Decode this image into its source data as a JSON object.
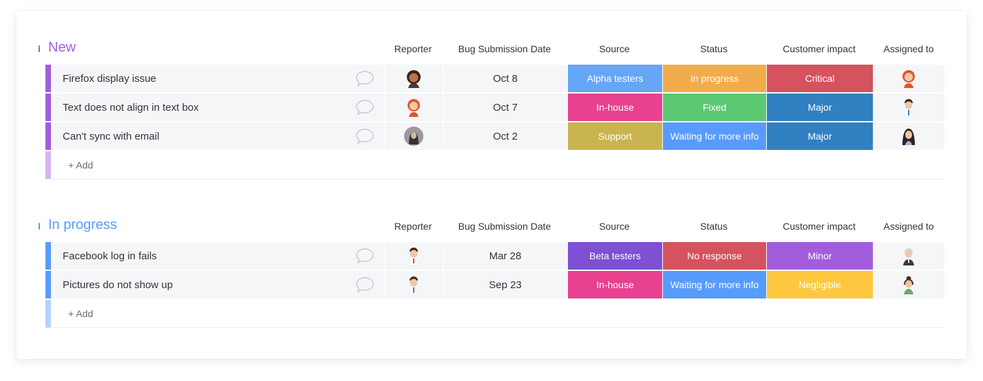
{
  "columns": {
    "reporter": "Reporter",
    "date": "Bug Submission Date",
    "source": "Source",
    "status": "Status",
    "impact": "Customer impact",
    "assigned": "Assigned to"
  },
  "colors": {
    "group_new": "#a25ddc",
    "group_in_progress": "#579bfc",
    "alpha_testers": "#66a6f6",
    "in_house": "#e8418f",
    "support": "#c9b44f",
    "beta_testers": "#7d50d4",
    "in_progress": "#f2ac4b",
    "fixed": "#5cc873",
    "waiting": "#579bfc",
    "no_response": "#d5525f",
    "critical": "#d5525f",
    "major": "#3080c2",
    "minor": "#a25ddc",
    "negligible": "#fdc740"
  },
  "groups": [
    {
      "title": "New",
      "color": "#a25ddc",
      "add_label": "+ Add",
      "rows": [
        {
          "name": "Firefox display issue",
          "reporter_icon": "avatar-woman-curly-icon",
          "date": "Oct 8",
          "source": "Alpha testers",
          "source_color": "#66a6f6",
          "status": "In progress",
          "status_color": "#f2ac4b",
          "impact": "Critical",
          "impact_color": "#d5525f",
          "assigned_icon": "avatar-woman-redhead-icon"
        },
        {
          "name": "Text does not align in text box",
          "reporter_icon": "avatar-woman-redhead-icon",
          "date": "Oct 7",
          "source": "In-house",
          "source_color": "#e8418f",
          "status": "Fixed",
          "status_color": "#5cc873",
          "impact": "Major",
          "impact_color": "#3080c2",
          "assigned_icon": "avatar-man-tie-icon"
        },
        {
          "name": "Can't sync with email",
          "reporter_icon": "avatar-woman-photo-icon",
          "date": "Oct 2",
          "source": "Support",
          "source_color": "#c9b44f",
          "status": "Waiting for more info",
          "status_color": "#579bfc",
          "impact": "Major",
          "impact_color": "#3080c2",
          "assigned_icon": "avatar-woman-dark-hair-icon"
        }
      ]
    },
    {
      "title": "In progress",
      "color": "#579bfc",
      "add_label": "+ Add",
      "rows": [
        {
          "name": "Facebook log in fails",
          "reporter_icon": "avatar-man-red-tie-icon",
          "date": "Mar 28",
          "source": "Beta testers",
          "source_color": "#7d50d4",
          "status": "No response",
          "status_color": "#d5525f",
          "impact": "Minor",
          "impact_color": "#a25ddc",
          "assigned_icon": "avatar-man-gray-icon"
        },
        {
          "name": "Pictures do not show up",
          "reporter_icon": "avatar-man-tie-icon",
          "date": "Sep 23",
          "source": "In-house",
          "source_color": "#e8418f",
          "status": "Waiting for more info",
          "status_color": "#579bfc",
          "impact": "Negligible",
          "impact_color": "#fdc740",
          "assigned_icon": "avatar-woman-bun-icon"
        }
      ]
    }
  ]
}
